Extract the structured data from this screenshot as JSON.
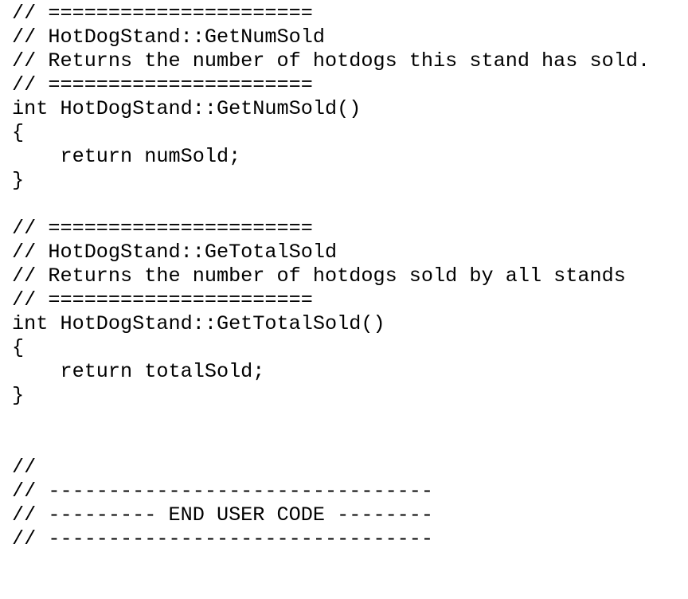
{
  "lines": [
    "// ======================",
    "// HotDogStand::GetNumSold",
    "// Returns the number of hotdogs this stand has sold.",
    "// ======================",
    "int HotDogStand::GetNumSold()",
    "{",
    "    return numSold;",
    "}",
    "",
    "// ======================",
    "// HotDogStand::GeTotalSold",
    "// Returns the number of hotdogs sold by all stands",
    "// ======================",
    "int HotDogStand::GetTotalSold()",
    "{",
    "    return totalSold;",
    "}",
    "",
    "",
    "//",
    "// --------------------------------",
    "// --------- END USER CODE --------",
    "// --------------------------------"
  ]
}
